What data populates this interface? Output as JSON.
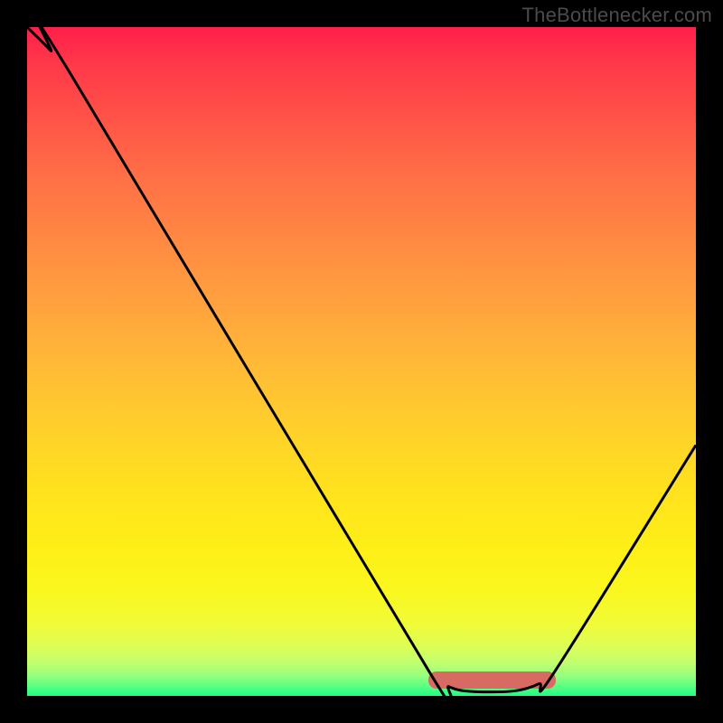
{
  "watermark": "TheBottlenecker.com",
  "colors": {
    "curve": "#000000",
    "highlight": "#d86a64",
    "frame": "#000000"
  },
  "chart_data": {
    "type": "line",
    "title": "",
    "xlabel": "",
    "ylabel": "",
    "xlim": [
      0,
      100
    ],
    "ylim": [
      0,
      100
    ],
    "series": [
      {
        "name": "bottleneck-curve",
        "x": [
          0,
          3.5,
          6.5,
          60.5,
          63.0,
          66.0,
          72.5,
          76.5,
          79.0,
          100
        ],
        "values": [
          100,
          96.5,
          93.0,
          3.0,
          1.4,
          0.7,
          0.7,
          1.8,
          3.8,
          37.5
        ]
      }
    ],
    "highlight_band": {
      "x_start": 60,
      "x_end": 79,
      "y": 1.4
    },
    "gradient_colors_top_to_bottom": [
      "#ff1f4a",
      "#ff3a49",
      "#ff5448",
      "#ff6e46",
      "#ff8443",
      "#ff9940",
      "#ffae3b",
      "#ffc233",
      "#ffd428",
      "#ffe31d",
      "#feef17",
      "#faf71e",
      "#f1fb36",
      "#defe56",
      "#c1ff6f",
      "#95ff7e",
      "#5bff83",
      "#1cff84"
    ]
  }
}
